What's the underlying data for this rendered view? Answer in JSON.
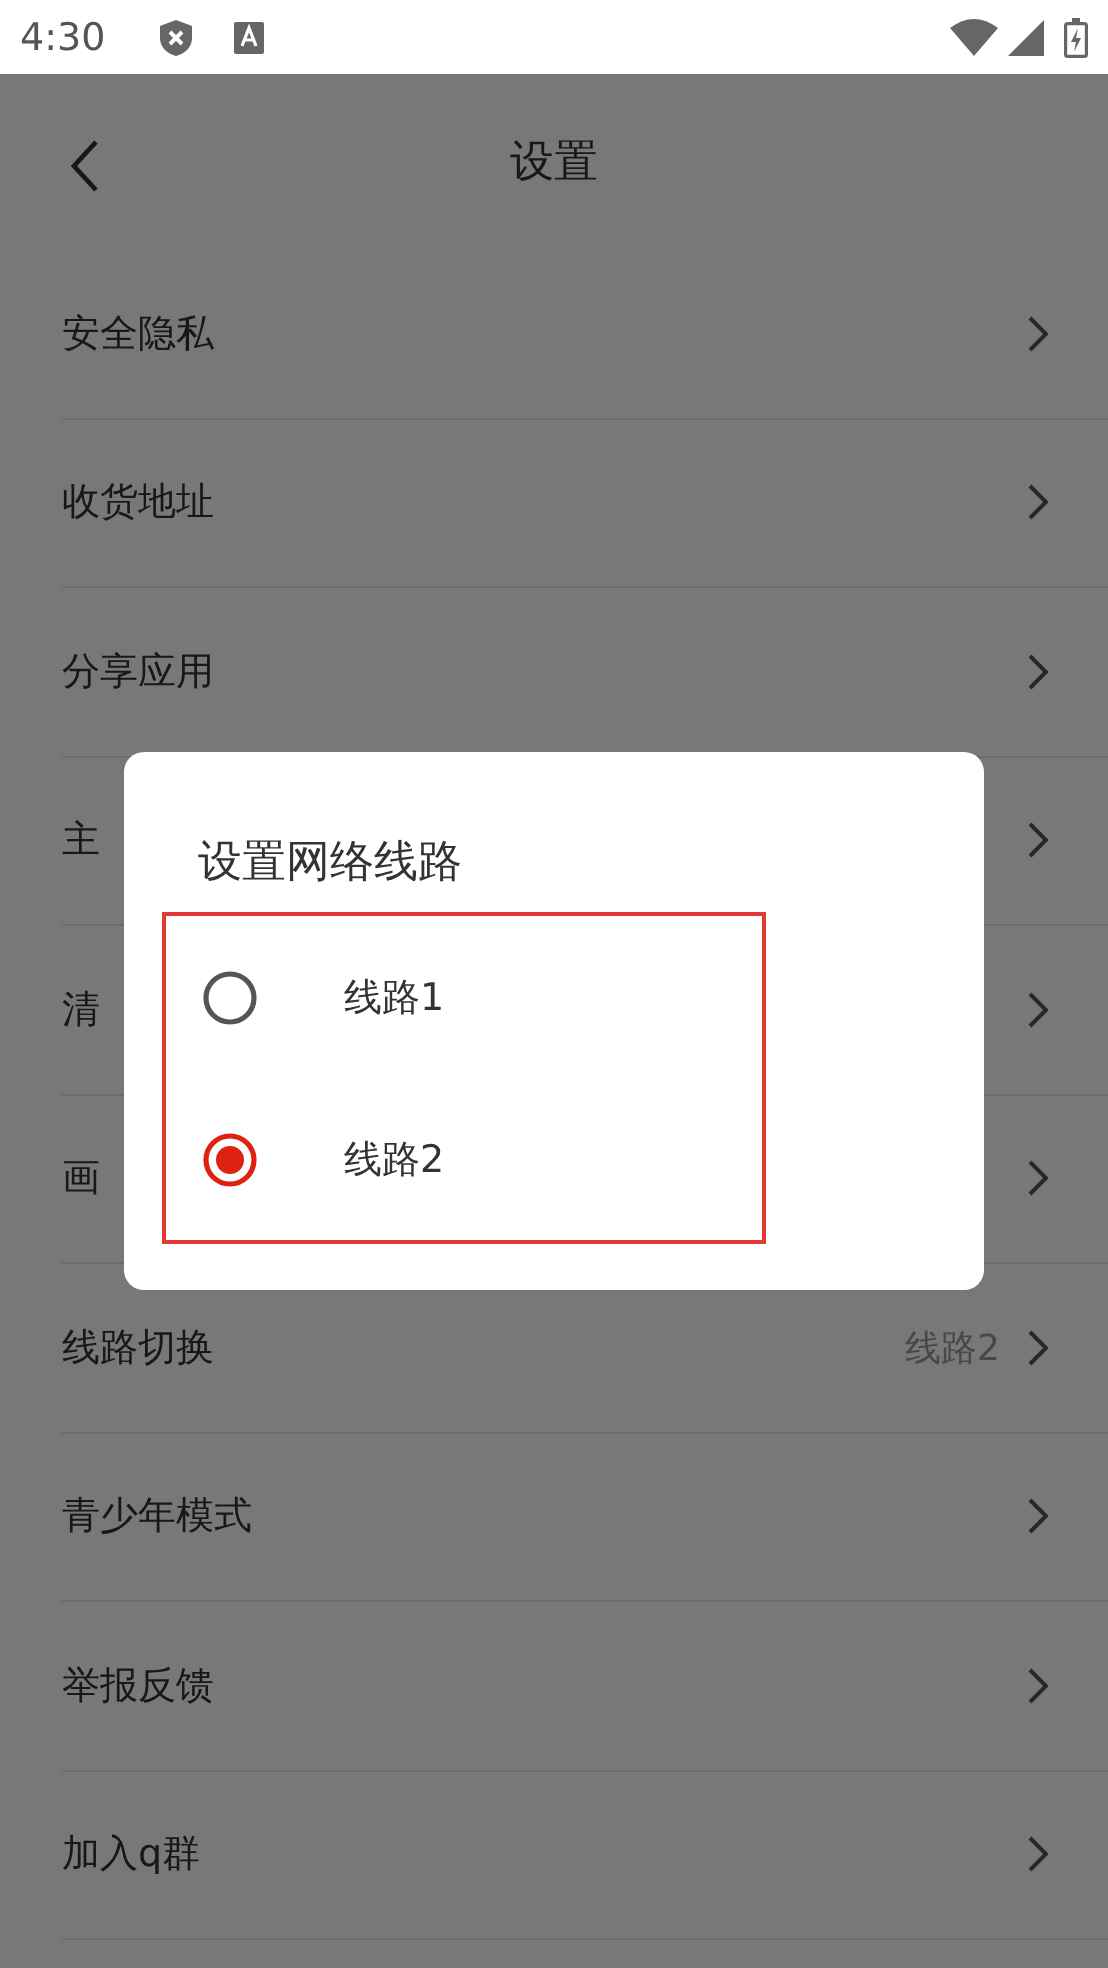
{
  "status_bar": {
    "time": "4:30"
  },
  "header": {
    "title": "设置"
  },
  "settings": [
    {
      "label": "安全隐私"
    },
    {
      "label": "收货地址"
    },
    {
      "label": "分享应用"
    },
    {
      "label": "主"
    },
    {
      "label": "清"
    },
    {
      "label": "画"
    },
    {
      "label": "线路切换",
      "value": "线路2"
    },
    {
      "label": "青少年模式"
    },
    {
      "label": "举报反馈"
    },
    {
      "label": "加入q群"
    }
  ],
  "dialog": {
    "title": "设置网络线路",
    "options": [
      {
        "label": "线路1",
        "selected": false
      },
      {
        "label": "线路2",
        "selected": true
      }
    ]
  }
}
